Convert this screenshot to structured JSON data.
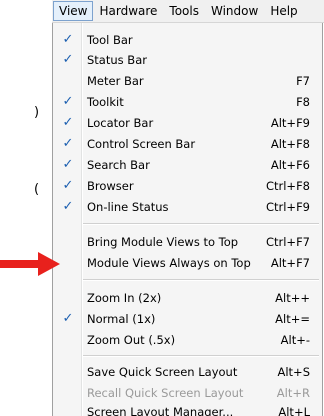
{
  "menubar": {
    "items": [
      "View",
      "Hardware",
      "Tools",
      "Window",
      "Help"
    ]
  },
  "view_menu": {
    "items": [
      {
        "label": "Tool Bar",
        "shortcut": "",
        "checked": true
      },
      {
        "label": "Status Bar",
        "shortcut": "",
        "checked": true
      },
      {
        "label": "Meter Bar",
        "shortcut": "F7",
        "checked": false
      },
      {
        "label": "Toolkit",
        "shortcut": "F8",
        "checked": true
      },
      {
        "label": "Locator Bar",
        "shortcut": "Alt+F9",
        "checked": true
      },
      {
        "label": "Control Screen Bar",
        "shortcut": "Alt+F8",
        "checked": true
      },
      {
        "label": "Search Bar",
        "shortcut": "Alt+F6",
        "checked": true
      },
      {
        "label": "Browser",
        "shortcut": "Ctrl+F8",
        "checked": true
      },
      {
        "label": "On-line Status",
        "shortcut": "Ctrl+F9",
        "checked": true
      },
      {
        "label": "Bring Module Views to Top",
        "shortcut": "Ctrl+F7",
        "checked": false
      },
      {
        "label": "Module Views Always on Top",
        "shortcut": "Alt+F7",
        "checked": false
      },
      {
        "label": "Zoom In (2x)",
        "shortcut": "Alt++",
        "checked": false
      },
      {
        "label": "Normal (1x)",
        "shortcut": "Alt+=",
        "checked": true
      },
      {
        "label": "Zoom Out (.5x)",
        "shortcut": "Alt+-",
        "checked": false
      },
      {
        "label": "Save Quick Screen Layout",
        "shortcut": "Alt+S",
        "checked": false
      },
      {
        "label": "Recall Quick Screen Layout",
        "shortcut": "Alt+R",
        "checked": false,
        "disabled": true
      },
      {
        "label": "Screen Layout Manager...",
        "shortcut": "Alt+L",
        "checked": false
      }
    ],
    "check_glyph": "✓"
  },
  "colors": {
    "check": "#1c5fb0",
    "arrow": "#e8211d",
    "disabled_text": "#9a9a9a"
  },
  "annotation": {
    "icon": "red-arrow-icon",
    "target_item": "Module Views Always on Top"
  }
}
